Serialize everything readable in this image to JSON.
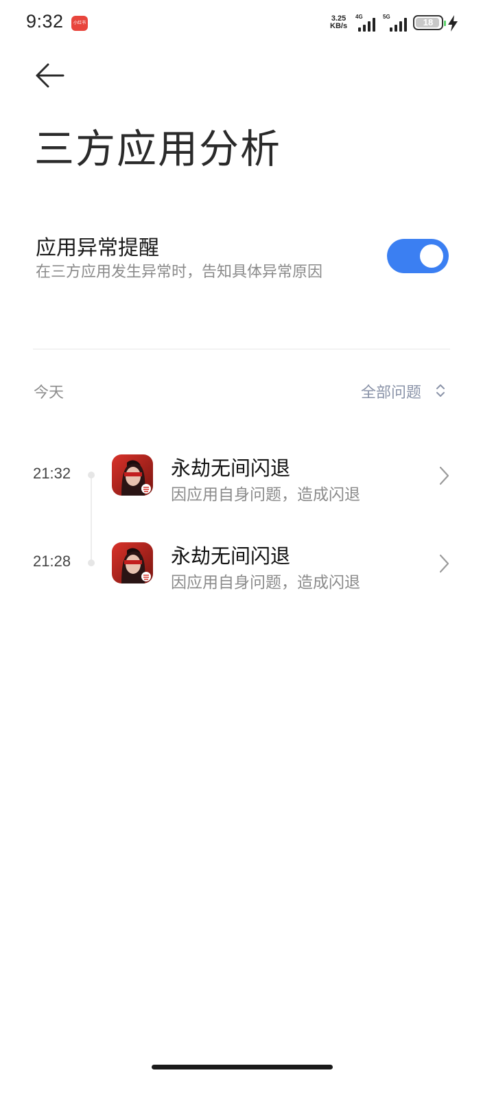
{
  "status_bar": {
    "time": "9:32",
    "notification_app_label": "小红书",
    "net_speed_value": "3.25",
    "net_speed_unit": "KB/s",
    "signal1_label": "4G",
    "signal2_label": "5G",
    "battery": "18",
    "colors": {
      "notification_app": "#e8453c",
      "battery_tip": "#5bd36a"
    }
  },
  "header": {
    "title": "三方应用分析"
  },
  "setting": {
    "title": "应用异常提醒",
    "description": "在三方应用发生异常时，告知具体异常原因",
    "toggle_on": true,
    "accent_color": "#3b7ff2"
  },
  "filter": {
    "date_label": "今天",
    "filter_label": "全部问题"
  },
  "crash_list": [
    {
      "time": "21:32",
      "title": "永劫无间闪退",
      "description": "因应用自身问题，造成闪退"
    },
    {
      "time": "21:28",
      "title": "永劫无间闪退",
      "description": "因应用自身问题，造成闪退"
    }
  ]
}
